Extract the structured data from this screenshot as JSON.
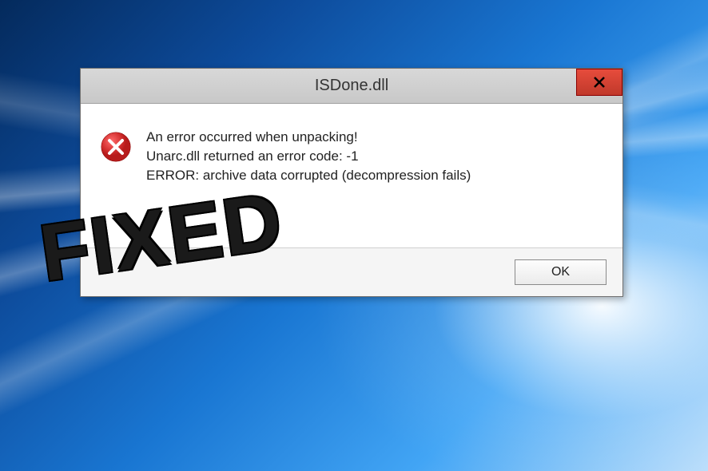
{
  "dialog": {
    "title": "ISDone.dll",
    "close_label": "Close",
    "message": {
      "line1": "An error occurred when unpacking!",
      "line2": "Unarc.dll returned an error code: -1",
      "line3": "ERROR: archive data corrupted (decompression fails)"
    },
    "ok_label": "OK"
  },
  "overlay": {
    "text": "FIXED"
  }
}
